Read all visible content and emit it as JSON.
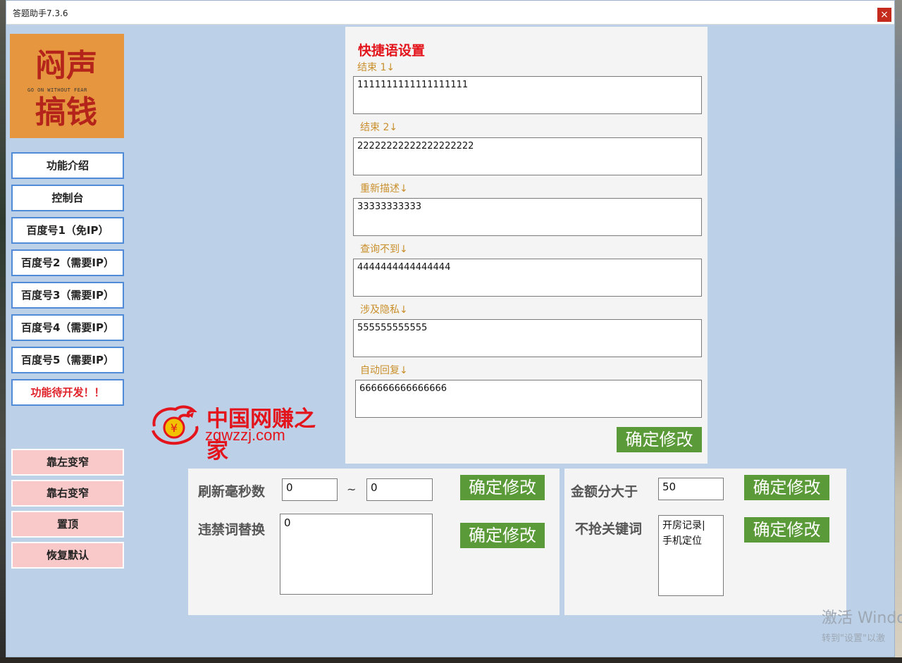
{
  "window": {
    "title": "答题助手7.3.6",
    "close_glyph": "×"
  },
  "logo": {
    "line1": "闷声",
    "line2": "搞钱",
    "motto": "GO ON WITHOUT FEAR"
  },
  "sidebar": {
    "items": [
      {
        "label": "功能介绍"
      },
      {
        "label": "控制台"
      },
      {
        "label": "百度号1（免IP）"
      },
      {
        "label": "百度号2（需要IP）"
      },
      {
        "label": "百度号3（需要IP）"
      },
      {
        "label": "百度号4（需要IP）"
      },
      {
        "label": "百度号5（需要IP）"
      },
      {
        "label": "功能待开发！！"
      }
    ],
    "layout_buttons": [
      {
        "label": "靠左变窄"
      },
      {
        "label": "靠右变窄"
      },
      {
        "label": "置顶"
      },
      {
        "label": "恢复默认"
      }
    ]
  },
  "quick_phrases": {
    "title": "快捷语设置",
    "fields": [
      {
        "label": "结束 1↓",
        "value": "1111111111111111111"
      },
      {
        "label": "结束 2↓",
        "value": "22222222222222222222"
      },
      {
        "label": "重新描述↓",
        "value": "33333333333"
      },
      {
        "label": "查询不到↓",
        "value": "4444444444444444"
      },
      {
        "label": "涉及隐私↓",
        "value": "555555555555"
      },
      {
        "label": "自动回复↓",
        "value": "666666666666666"
      }
    ],
    "confirm_label": "确定修改"
  },
  "refresh": {
    "label": "刷新毫秒数",
    "min_value": "0",
    "separator": "~",
    "max_value": "0",
    "confirm_label": "确定修改"
  },
  "banned_words": {
    "label": "违禁词替换",
    "value": "0",
    "confirm_label": "确定修改"
  },
  "amount": {
    "label": "金额分大于",
    "value": "50",
    "confirm_label": "确定修改"
  },
  "skip_keywords": {
    "label": "不抢关键词",
    "lines": [
      "开房记录|",
      "手机定位"
    ],
    "confirm_label": "确定修改"
  },
  "watermark": {
    "cn": "中国网赚之家",
    "url": "zgwzzj.com"
  },
  "activation": {
    "line1": "激活 Windo",
    "line2": "转到\"设置\"以激"
  },
  "colors": {
    "accent_red": "#e3141c",
    "button_green": "#5b9a38",
    "label_gold": "#c98f2c",
    "window_bg": "#bcd1e8"
  }
}
